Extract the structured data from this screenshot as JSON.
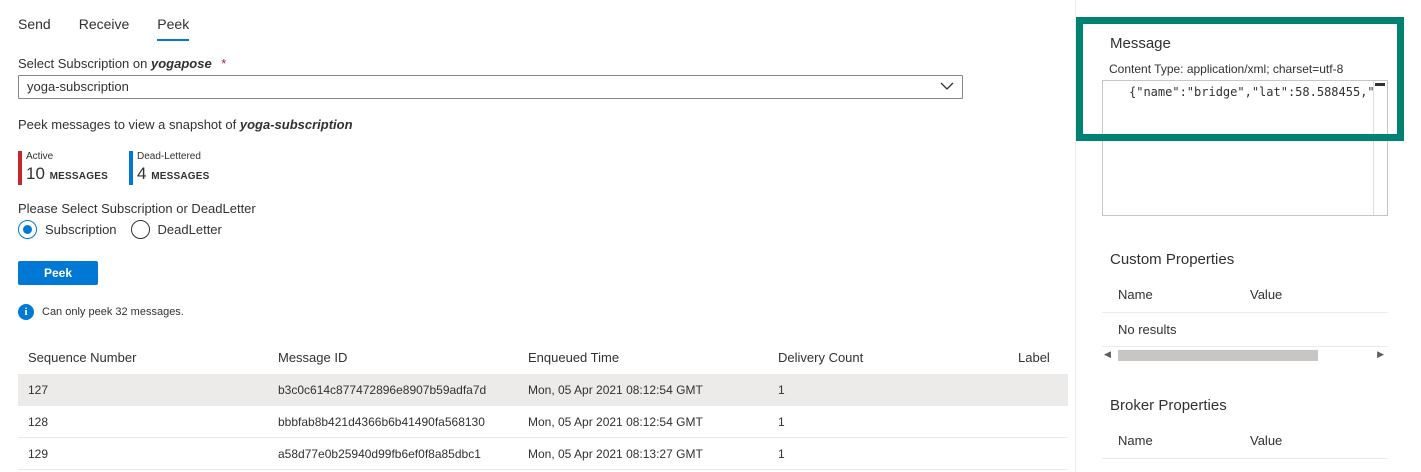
{
  "tabs": [
    {
      "label": "Send"
    },
    {
      "label": "Receive"
    },
    {
      "label": "Peek"
    }
  ],
  "subscription": {
    "label_prefix": "Select Subscription on",
    "topic": "yogapose",
    "required_mark": "*",
    "selected": "yoga-subscription"
  },
  "peek_info": {
    "prefix": "Peek messages to view a snapshot of",
    "subscription": "yoga-subscription"
  },
  "stats": {
    "active": {
      "caption": "Active",
      "count": "10",
      "unit": "MESSAGES",
      "color": "#c4262e"
    },
    "dead": {
      "caption": "Dead-Lettered",
      "count": "4",
      "unit": "MESSAGES",
      "color": "#0078d4"
    }
  },
  "choice": {
    "label": "Please Select Subscription or DeadLetter",
    "options": [
      "Subscription",
      "DeadLetter"
    ],
    "selected": "Subscription"
  },
  "peek_button": "Peek",
  "info_text": "Can only peek 32 messages.",
  "grid": {
    "headers": [
      "Sequence Number",
      "Message ID",
      "Enqueued Time",
      "Delivery Count",
      "Label"
    ],
    "rows": [
      [
        "127",
        "b3c0c614c877472896e8907b59adfa7d",
        "Mon, 05 Apr 2021 08:12:54 GMT",
        "1",
        ""
      ],
      [
        "128",
        "bbbfab8b421d4366b6b41490fa568130",
        "Mon, 05 Apr 2021 08:12:54 GMT",
        "1",
        ""
      ],
      [
        "129",
        "a58d77e0b25940d99fb6ef0f8a85dbc1",
        "Mon, 05 Apr 2021 08:13:27 GMT",
        "1",
        ""
      ]
    ]
  },
  "message_panel": {
    "title": "Message",
    "content_type": "Content Type: application/xml; charset=utf-8",
    "body": "{\"name\":\"bridge\",\"lat\":58.588455,\""
  },
  "custom_properties": {
    "title": "Custom Properties",
    "col_name": "Name",
    "col_value": "Value",
    "empty": "No results"
  },
  "broker_properties": {
    "title": "Broker Properties",
    "col_name": "Name",
    "col_value": "Value"
  },
  "colors": {
    "accent": "#0078d4",
    "highlight": "#008272"
  }
}
